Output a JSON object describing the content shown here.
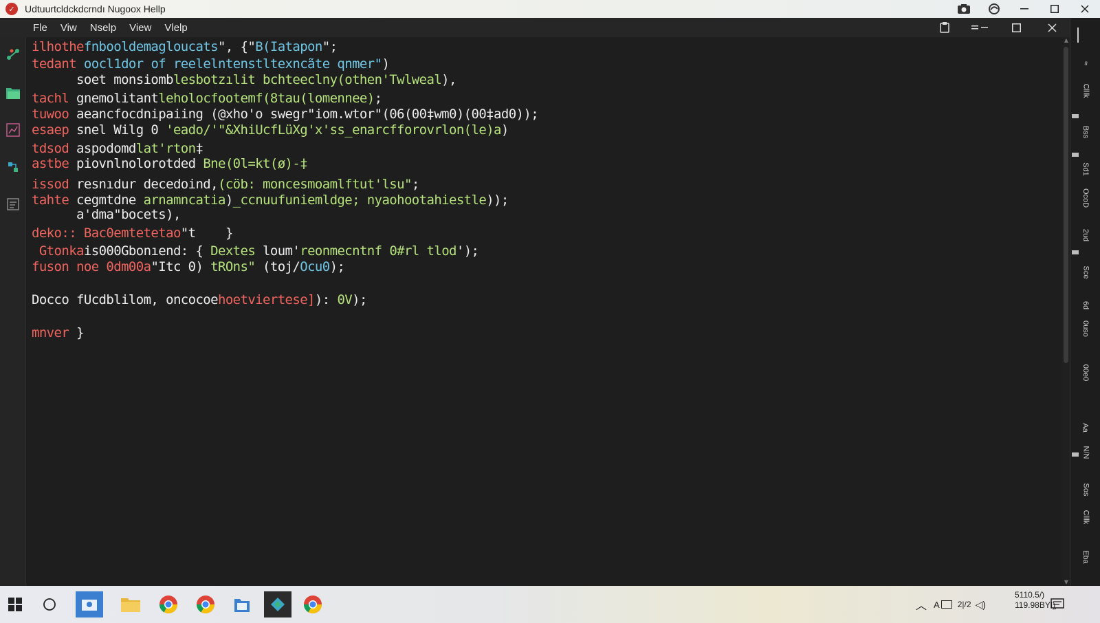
{
  "window": {
    "title": "Udtuurtcldckdcrndı Nugoox Hellp"
  },
  "menu": {
    "items": [
      "Fle",
      "Viw",
      "Nselp",
      "View",
      "Vlelp"
    ]
  },
  "editor": {
    "lines": [
      {
        "y": 0,
        "parts": [
          [
            "kw",
            "ilhothe"
          ],
          [
            "fn",
            "fnbooldemagloucats"
          ],
          [
            "txt",
            "\", {\""
          ],
          [
            "fn",
            "B(Iatapon"
          ],
          [
            "txt",
            "\";"
          ]
        ]
      },
      {
        "y": 1,
        "parts": [
          [
            "kw",
            "tedant"
          ],
          [
            "txt",
            " "
          ],
          [
            "fn",
            "oocl1dor of reelelntenstltexncãte qnmer\""
          ],
          [
            "txt",
            ")"
          ]
        ]
      },
      {
        "y": 2,
        "parts": [
          [
            "txt",
            "      soet monsiomb"
          ],
          [
            "str",
            "lesbotzılit bchteeclny(othen'Twlweal"
          ],
          [
            "txt",
            "),"
          ]
        ]
      },
      {
        "y": 3,
        "parts": [
          [
            "kw",
            "tachl"
          ],
          [
            "txt",
            " gnemolitant"
          ],
          [
            "str",
            "leholocfootemf(8tau(lomennee)"
          ],
          [
            "txt",
            ";"
          ]
        ]
      },
      {
        "y": 4,
        "parts": [
          [
            "kw",
            "tuwoo"
          ],
          [
            "txt",
            " aeancfocdnipaiing (@xho'o swegr\"iom.wtor\"(06(00‡wm0)(00‡ad0));"
          ]
        ]
      },
      {
        "y": 5,
        "parts": [
          [
            "kw",
            "esaep"
          ],
          [
            "txt",
            " snel Wilg 0 "
          ],
          [
            "str",
            "'eado/'\"&XhiUcfLüXg'x'ss_enarcfforovrlon(le)a"
          ],
          [
            "txt",
            ")"
          ]
        ]
      },
      {
        "y": 6,
        "parts": [
          [
            "kw",
            "tdsod"
          ],
          [
            "txt",
            " aspodomd"
          ],
          [
            "str",
            "lat'rton"
          ],
          [
            "txt",
            "‡"
          ]
        ]
      },
      {
        "y": 7,
        "parts": [
          [
            "kw",
            "astbe"
          ],
          [
            "txt",
            " piovnlnolorotded "
          ],
          [
            "str",
            "Bne(0l=kt(ø)-‡"
          ]
        ]
      },
      {
        "y": 8,
        "parts": [
          [
            "kw",
            "issod"
          ],
          [
            "txt",
            " resnıdur decedoind,"
          ],
          [
            "str",
            "(cöb: moncesmoamlftut'lsu\""
          ],
          [
            "txt",
            ";"
          ]
        ]
      },
      {
        "y": 9,
        "parts": [
          [
            "kw",
            "tahte"
          ],
          [
            "txt",
            " cegmtdne "
          ],
          [
            "str",
            "arnamncatia"
          ],
          [
            "txt",
            ")"
          ],
          [
            "str",
            "_ccnuufuniemldge; nyaohootahiestle"
          ],
          [
            "txt",
            "));"
          ]
        ]
      },
      {
        "y": 10,
        "parts": [
          [
            "txt",
            "      a'dma\"bocets),"
          ]
        ]
      },
      {
        "y": 11,
        "parts": [
          [
            "kw",
            "deko:: Bac0emtetetao"
          ],
          [
            "txt",
            "\"t    }"
          ]
        ]
      },
      {
        "y": 12,
        "parts": [
          [
            "txt",
            " "
          ],
          [
            "kw",
            "Gtonka"
          ],
          [
            "txt",
            "is000Gbonıend: { "
          ],
          [
            "str",
            "Dextes"
          ],
          [
            "txt",
            " loum'"
          ],
          [
            "str",
            "reonmecntnf 0#rl tlod"
          ],
          [
            "txt",
            "');"
          ]
        ]
      },
      {
        "y": 13,
        "parts": [
          [
            "kw",
            "fuson noe 0dm00a"
          ],
          [
            "txt",
            "\"Itc 0) "
          ],
          [
            "str",
            "tROns\""
          ],
          [
            "txt",
            " (toj/"
          ],
          [
            "fn",
            "Ocu0"
          ],
          [
            "txt",
            ");"
          ]
        ]
      },
      {
        "y": 14,
        "parts": [
          [
            "txt",
            "Docco fUcdblilom, oncocoe"
          ],
          [
            "kw",
            "hoetviertese]"
          ],
          [
            "txt",
            "): "
          ],
          [
            "str",
            "0V"
          ],
          [
            "txt",
            ");"
          ]
        ]
      },
      {
        "y": 15,
        "parts": [
          [
            "kw",
            "mnver"
          ],
          [
            "txt",
            " }"
          ]
        ]
      }
    ]
  },
  "right_panel": {
    "labels": [
      "≈",
      "Clllk",
      "Bss",
      "Sd1",
      "OcoD",
      "2ud",
      "Sce",
      "6d",
      "0uso",
      "00e0",
      "Aa",
      "N/N",
      "Sos",
      "Clllk",
      "Eba"
    ]
  },
  "taskbar": {
    "tray_text": "A",
    "tray_lang": "2|/2",
    "clock_line1": "5110.5/)",
    "clock_line2": "119.98BYI)"
  },
  "colors": {
    "keyword": "#f0645e",
    "function": "#6ec5e6",
    "string": "#b5e27a",
    "text": "#ececec",
    "editor_bg": "#1e1e1e"
  }
}
